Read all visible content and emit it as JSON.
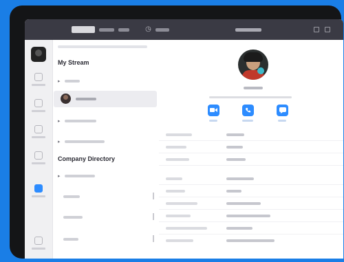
{
  "sections": {
    "my_stream": "My Stream",
    "company_directory": "Company Directory"
  },
  "colors": {
    "accent": "#2d8cff",
    "background": "#1a7ee6",
    "topbar": "#3a3a44"
  },
  "icons": {
    "video": "video-camera-icon",
    "phone": "phone-icon",
    "chat": "chat-bubble-icon"
  }
}
